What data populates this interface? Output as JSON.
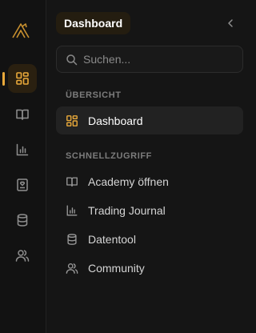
{
  "colors": {
    "accent": "#e9a93a",
    "background": "#151515",
    "rail": "#121212",
    "active_row": "#222222"
  },
  "rail": {
    "logo_icon": "mountain-logo-icon",
    "items": [
      {
        "icon": "dashboard-grid-icon",
        "active": true
      },
      {
        "icon": "book-open-icon",
        "active": false
      },
      {
        "icon": "bar-chart-icon",
        "active": false
      },
      {
        "icon": "journal-heart-icon",
        "active": false
      },
      {
        "icon": "database-icon",
        "active": false
      },
      {
        "icon": "users-icon",
        "active": false
      }
    ]
  },
  "header": {
    "title": "Dashboard",
    "collapse_icon": "chevron-left-icon"
  },
  "search": {
    "placeholder": "Suchen...",
    "value": ""
  },
  "sections": [
    {
      "label": "ÜBERSICHT",
      "items": [
        {
          "label": "Dashboard",
          "icon": "dashboard-grid-icon",
          "active": true
        }
      ]
    },
    {
      "label": "SCHNELLZUGRIFF",
      "items": [
        {
          "label": "Academy öffnen",
          "icon": "book-open-icon"
        },
        {
          "label": "Trading Journal",
          "icon": "bar-chart-icon"
        },
        {
          "label": "Datentool",
          "icon": "database-icon"
        },
        {
          "label": "Community",
          "icon": "users-icon"
        }
      ]
    }
  ]
}
